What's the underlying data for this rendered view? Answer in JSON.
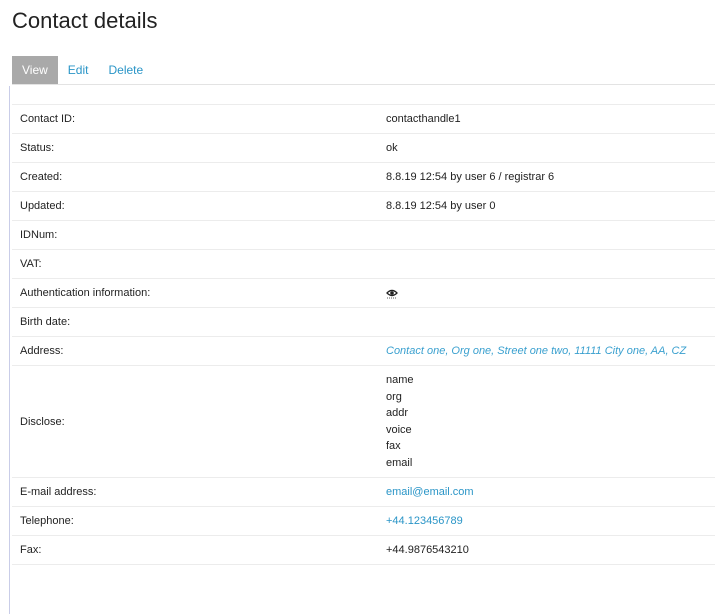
{
  "header": {
    "title": "Contact details"
  },
  "tabs": [
    {
      "label": "View",
      "active": true
    },
    {
      "label": "Edit",
      "active": false
    },
    {
      "label": "Delete",
      "active": false
    }
  ],
  "details": {
    "contact_id": {
      "label": "Contact ID:",
      "value": "contacthandle1"
    },
    "status": {
      "label": "Status:",
      "value": "ok"
    },
    "created": {
      "label": "Created:",
      "value": "8.8.19 12:54 by user 6 / registrar 6"
    },
    "updated": {
      "label": "Updated:",
      "value": "8.8.19 12:54 by user 0"
    },
    "idnum": {
      "label": "IDNum:",
      "value": ""
    },
    "vat": {
      "label": "VAT:",
      "value": ""
    },
    "auth_info": {
      "label": "Authentication information:",
      "icon": "eye-icon"
    },
    "birth_date": {
      "label": "Birth date:",
      "value": ""
    },
    "address": {
      "label": "Address:",
      "value": "Contact one, Org one, Street one two, 11111 City one, AA, CZ"
    },
    "disclose": {
      "label": "Disclose:",
      "values": [
        "name",
        "org",
        "addr",
        "voice",
        "fax",
        "email"
      ]
    },
    "email": {
      "label": "E-mail address:",
      "value": "email@email.com"
    },
    "telephone": {
      "label": "Telephone:",
      "value": "+44.123456789"
    },
    "fax": {
      "label": "Fax:",
      "value": "+44.9876543210"
    }
  },
  "colors": {
    "link": "#2a95c7",
    "active_tab_bg": "#a9a9a9",
    "border": "#ececec"
  }
}
